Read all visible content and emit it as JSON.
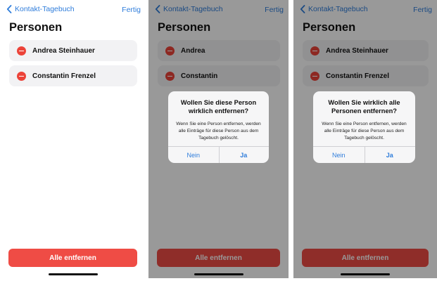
{
  "nav": {
    "back_label": "Kontakt-Tagebuch",
    "done_label": "Fertig"
  },
  "title": "Personen",
  "screens": [
    {
      "persons": [
        "Andrea Steinhauer",
        "Constantin Frenzel"
      ]
    },
    {
      "persons": [
        "Andrea",
        "Constantin"
      ],
      "alert": {
        "title": "Wollen Sie diese Person wirklich entfernen?",
        "message": "Wenn Sie eine Person entfernen, werden alle Einträge für diese Person aus dem Tagebuch gelöscht.",
        "cancel": "Nein",
        "confirm": "Ja"
      }
    },
    {
      "persons": [
        "Andrea Steinhauer",
        "Constantin Frenzel"
      ],
      "alert": {
        "title": "Wollen Sie wirklich alle Personen entfernen?",
        "message": "Wenn Sie eine Person entfernen, werden alle Einträge für diese Person aus dem Tagebuch gelöscht.",
        "cancel": "Nein",
        "confirm": "Ja"
      }
    }
  ],
  "remove_all_label": "Alle entfernen",
  "colors": {
    "accent": "#2f7ddb",
    "destructive": "#ef4c45",
    "row_bg": "#f2f2f4"
  },
  "icons": {
    "back": "chevron-left-icon",
    "remove": "minus-circle-icon"
  }
}
